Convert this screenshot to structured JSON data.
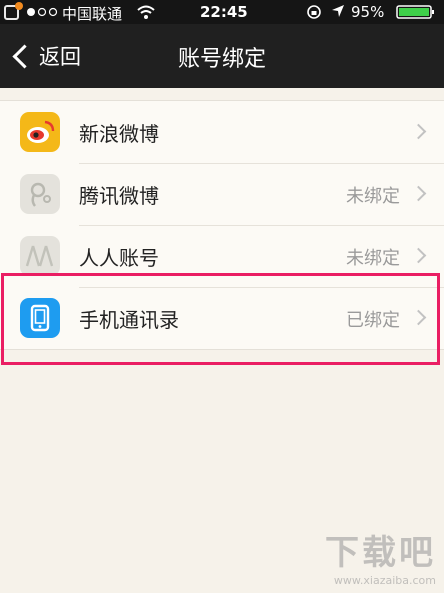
{
  "status_bar": {
    "carrier": "中国联通",
    "time": "22:45",
    "battery": "95%",
    "icons": [
      "notification-icon",
      "signal-dots-icon",
      "wifi-icon",
      "rotation-lock-icon",
      "location-icon",
      "battery-icon"
    ]
  },
  "nav": {
    "back_label": "返回",
    "title": "账号绑定"
  },
  "accounts": [
    {
      "label": "新浪微博",
      "status": "",
      "icon": "weibo-icon"
    },
    {
      "label": "腾讯微博",
      "status": "未绑定",
      "icon": "tencent-weibo-icon"
    },
    {
      "label": "人人账号",
      "status": "未绑定",
      "icon": "renren-icon"
    },
    {
      "label": "手机通讯录",
      "status": "已绑定",
      "icon": "phone-contacts-icon"
    }
  ],
  "watermark": {
    "name": "下载吧",
    "url": "www.xiazaiba.com"
  },
  "colors": {
    "highlight": "#ea1e63",
    "weibo": "#f4b818",
    "contacts": "#1e9cf0"
  }
}
